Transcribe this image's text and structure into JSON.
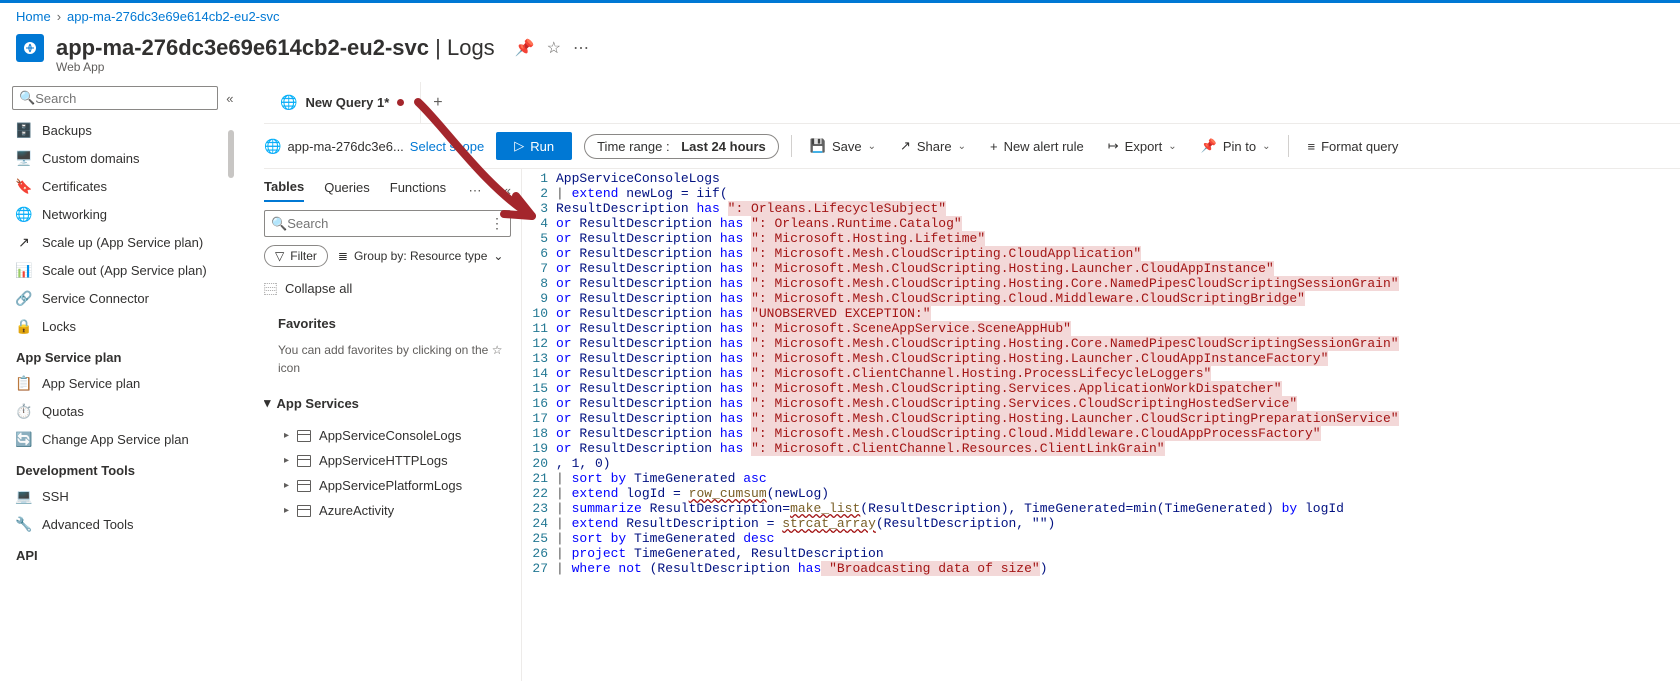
{
  "breadcrumb": {
    "home": "Home",
    "current": "app-ma-276dc3e69e614cb2-eu2-svc"
  },
  "header": {
    "title_app": "app-ma-276dc3e69e614cb2-eu2-svc",
    "title_section": "Logs",
    "subtitle": "Web App"
  },
  "sidebar": {
    "search_placeholder": "Search",
    "items1": [
      {
        "label": "Backups"
      },
      {
        "label": "Custom domains"
      },
      {
        "label": "Certificates"
      },
      {
        "label": "Networking"
      },
      {
        "label": "Scale up (App Service plan)"
      },
      {
        "label": "Scale out (App Service plan)"
      },
      {
        "label": "Service Connector"
      },
      {
        "label": "Locks"
      }
    ],
    "section_plan": "App Service plan",
    "items2": [
      {
        "label": "App Service plan"
      },
      {
        "label": "Quotas"
      },
      {
        "label": "Change App Service plan"
      }
    ],
    "section_dev": "Development Tools",
    "items3": [
      {
        "label": "SSH"
      },
      {
        "label": "Advanced Tools"
      }
    ],
    "section_api": "API"
  },
  "tabs": {
    "query_tab": "New Query 1*"
  },
  "toolbar": {
    "scope_app": "app-ma-276dc3e6...",
    "select_scope": "Select scope",
    "run": "Run",
    "time_label": "Time range :",
    "time_value": "Last 24 hours",
    "save": "Save",
    "share": "Share",
    "new_alert": "New alert rule",
    "export": "Export",
    "pin": "Pin to",
    "format": "Format query"
  },
  "qpanel": {
    "tab_tables": "Tables",
    "tab_queries": "Queries",
    "tab_functions": "Functions",
    "search_placeholder": "Search",
    "filter": "Filter",
    "group_by": "Group by: Resource type",
    "collapse_all": "Collapse all",
    "favorites": "Favorites",
    "fav_text": "You can add favorites by clicking on the ☆ icon",
    "app_services": "App Services",
    "tables": [
      "AppServiceConsoleLogs",
      "AppServiceHTTPLogs",
      "AppServicePlatformLogs",
      "AzureActivity"
    ]
  },
  "code": {
    "lines": [
      {
        "n": 1,
        "t": "plain",
        "text": "AppServiceConsoleLogs"
      },
      {
        "n": 2,
        "t": "extend",
        "pre": "| ",
        "kw": "extend",
        "rest": " newLog = iif("
      },
      {
        "n": 3,
        "t": "has_first",
        "field": "ResultDescription",
        "op": "has",
        "str": "\": Orleans.LifecycleSubject\""
      },
      {
        "n": 4,
        "t": "has",
        "field": "ResultDescription",
        "op": "has",
        "str": "\": Orleans.Runtime.Catalog\""
      },
      {
        "n": 5,
        "t": "has",
        "field": "ResultDescription",
        "op": "has",
        "str": "\": Microsoft.Hosting.Lifetime\""
      },
      {
        "n": 6,
        "t": "has",
        "field": "ResultDescription",
        "op": "has",
        "str": "\": Microsoft.Mesh.CloudScripting.CloudApplication\""
      },
      {
        "n": 7,
        "t": "has",
        "field": "ResultDescription",
        "op": "has",
        "str": "\": Microsoft.Mesh.CloudScripting.Hosting.Launcher.CloudAppInstance\""
      },
      {
        "n": 8,
        "t": "has",
        "field": "ResultDescription",
        "op": "has",
        "str": "\": Microsoft.Mesh.CloudScripting.Hosting.Core.NamedPipesCloudScriptingSessionGrain\""
      },
      {
        "n": 9,
        "t": "has",
        "field": "ResultDescription",
        "op": "has",
        "str": "\": Microsoft.Mesh.CloudScripting.Cloud.Middleware.CloudScriptingBridge\""
      },
      {
        "n": 10,
        "t": "has",
        "field": "ResultDescription",
        "op": "has",
        "str": "\"UNOBSERVED EXCEPTION:\""
      },
      {
        "n": 11,
        "t": "has",
        "field": "ResultDescription",
        "op": "has",
        "str": "\": Microsoft.SceneAppService.SceneAppHub\""
      },
      {
        "n": 12,
        "t": "has",
        "field": "ResultDescription",
        "op": "has",
        "str": "\": Microsoft.Mesh.CloudScripting.Hosting.Core.NamedPipesCloudScriptingSessionGrain\""
      },
      {
        "n": 13,
        "t": "has",
        "field": "ResultDescription",
        "op": "has",
        "str": "\": Microsoft.Mesh.CloudScripting.Hosting.Launcher.CloudAppInstanceFactory\""
      },
      {
        "n": 14,
        "t": "has",
        "field": "ResultDescription",
        "op": "has",
        "str": "\": Microsoft.ClientChannel.Hosting.ProcessLifecycleLoggers\""
      },
      {
        "n": 15,
        "t": "has",
        "field": "ResultDescription",
        "op": "has",
        "str": "\": Microsoft.Mesh.CloudScripting.Services.ApplicationWorkDispatcher\""
      },
      {
        "n": 16,
        "t": "has",
        "field": "ResultDescription",
        "op": "has",
        "str": "\": Microsoft.Mesh.CloudScripting.Services.CloudScriptingHostedService\""
      },
      {
        "n": 17,
        "t": "has",
        "field": "ResultDescription",
        "op": "has",
        "str": "\": Microsoft.Mesh.CloudScripting.Hosting.Launcher.CloudScriptingPreparationService\""
      },
      {
        "n": 18,
        "t": "has",
        "field": "ResultDescription",
        "op": "has",
        "str": "\": Microsoft.Mesh.CloudScripting.Cloud.Middleware.CloudAppProcessFactory\""
      },
      {
        "n": 19,
        "t": "has",
        "field": "ResultDescription",
        "op": "has",
        "str": "\": Microsoft.ClientChannel.Resources.ClientLinkGrain\""
      },
      {
        "n": 20,
        "t": "plain",
        "text": ", 1, 0)"
      },
      {
        "n": 21,
        "t": "sort",
        "kw": "sort by",
        "rest": " TimeGenerated ",
        "kw2": "asc"
      },
      {
        "n": 22,
        "t": "extendfn",
        "kw": "extend",
        "mid": " logId = ",
        "fn": "row_cumsum",
        "args": "(newLog)"
      },
      {
        "n": 23,
        "t": "summarize",
        "kw": "summarize",
        "mid": " ResultDescription=",
        "fn": "make_list",
        "args": "(ResultDescription)",
        "rest": ", TimeGenerated=min(TimeGenerated) ",
        "kw2": "by",
        "rest2": " logId"
      },
      {
        "n": 24,
        "t": "extendfn",
        "kw": "extend",
        "mid": " ResultDescription = ",
        "fn": "strcat_array",
        "args": "(ResultDescription, \"\")"
      },
      {
        "n": 25,
        "t": "sort",
        "kw": "sort by",
        "rest": " TimeGenerated ",
        "kw2": "desc"
      },
      {
        "n": 26,
        "t": "pipe_kw",
        "kw": "project",
        "rest": " TimeGenerated, ResultDescription"
      },
      {
        "n": 27,
        "t": "where",
        "kw": "where not",
        "mid": " (ResultDescription ",
        "op": "has",
        "str": " \"Broadcasting data of size\"",
        "rest": ")"
      }
    ]
  }
}
